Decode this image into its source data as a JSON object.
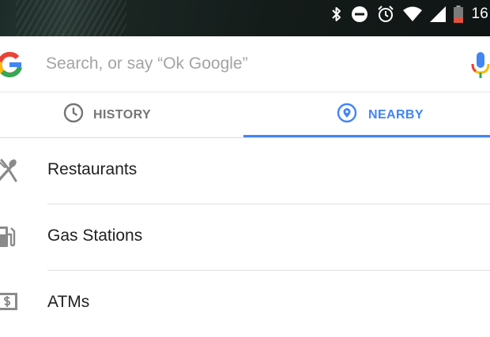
{
  "status_bar": {
    "time": "16",
    "icons": [
      "bluetooth-icon",
      "do-not-disturb-icon",
      "alarm-icon",
      "wifi-icon",
      "cell-signal-icon",
      "battery-low-icon"
    ],
    "battery_color": "#e2533f"
  },
  "search": {
    "logo_letter": "G",
    "placeholder": "Search, or say “Ok Google”",
    "value": "",
    "icon": "mic-icon"
  },
  "tabs": [
    {
      "label": "HISTORY",
      "icon": "clock-icon",
      "selected": false
    },
    {
      "label": "NEARBY",
      "icon": "location-pin-icon",
      "selected": true
    }
  ],
  "nearby_items": [
    {
      "label": "Restaurants",
      "icon": "fork-knife-icon"
    },
    {
      "label": "Gas Stations",
      "icon": "gas-pump-icon"
    },
    {
      "label": "ATMs",
      "icon": "dollar-bill-icon"
    }
  ],
  "colors": {
    "accent": "#4285f4",
    "tab_inactive": "#757575",
    "text_primary": "#212121",
    "placeholder": "#a3a3a3"
  }
}
